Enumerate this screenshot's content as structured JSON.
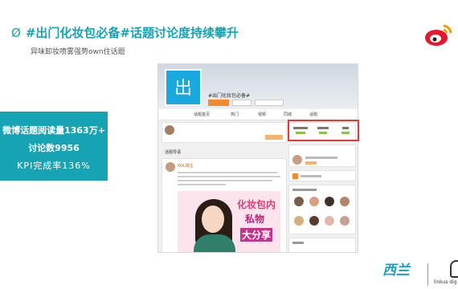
{
  "slide": {
    "title_mark": "Ø",
    "title": "#出门化妆包必备#话题讨论度持续攀升",
    "subtitle": "异味卸妆喷雾强势own住话题"
  },
  "stats": {
    "read_line": "微博话题阅读量1363万+",
    "discuss_line": "讨论数9956",
    "kpi_line": "KPI完成率136%"
  },
  "screenshot": {
    "avatar_char": "出",
    "topic_name": "#出门化妆包必备#",
    "tabs": [
      "话题首页",
      "热门",
      "视频",
      "同城",
      "话题"
    ],
    "section_label": "话题导语",
    "username": "KOL博主",
    "poster_lines": [
      "化妆包内",
      "私物",
      "大分享"
    ]
  },
  "colors": {
    "accent": "#16a3b4",
    "highlight": "#e53935",
    "weibo_red": "#e6162d"
  },
  "icons": [
    "weibo-logo-icon",
    "xilan-logo-icon",
    "linkus-logo-icon"
  ],
  "brand": {
    "xilan": "西兰",
    "linkus": "linkus dig"
  }
}
